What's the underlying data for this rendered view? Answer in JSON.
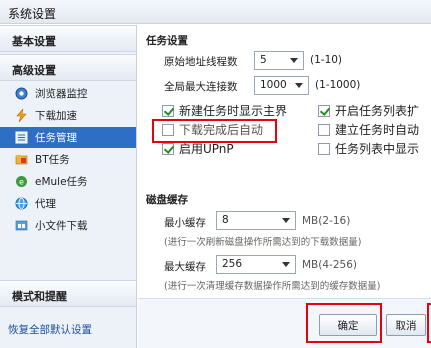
{
  "window": {
    "title": "系统设置"
  },
  "sidebar": {
    "sections": {
      "basic": "基本设置",
      "advanced": "高级设置",
      "mode": "模式和提醒"
    },
    "items": [
      {
        "label": "浏览器监控",
        "icon": "browser-monitor-icon"
      },
      {
        "label": "下载加速",
        "icon": "lightning-icon"
      },
      {
        "label": "任务管理",
        "icon": "task-list-icon",
        "active": true
      },
      {
        "label": "BT任务",
        "icon": "bt-folder-icon"
      },
      {
        "label": "eMule任务",
        "icon": "emule-icon"
      },
      {
        "label": "代理",
        "icon": "proxy-globe-icon"
      },
      {
        "label": "小文件下载",
        "icon": "small-file-icon"
      }
    ],
    "restore_link": "恢复全部默认设置"
  },
  "task_settings": {
    "title": "任务设置",
    "origin_threads_label": "原始地址线程数",
    "origin_threads_value": "5",
    "origin_threads_range": "(1-10)",
    "max_conn_label": "全局最大连接数",
    "max_conn_value": "1000",
    "max_conn_range": "(1-1000)",
    "checkboxes": [
      {
        "label": "新建任务时显示主界",
        "checked": true
      },
      {
        "label": "开启任务列表扩",
        "checked": true
      },
      {
        "label": "下载完成后自动",
        "checked": false
      },
      {
        "label": "建立任务时自动",
        "checked": false
      },
      {
        "label": "启用UPnP",
        "checked": true
      },
      {
        "label": "任务列表中显示",
        "checked": false
      }
    ]
  },
  "disk_cache": {
    "title": "磁盘缓存",
    "min_label": "最小缓存",
    "min_value": "8",
    "min_range": "MB(2-16)",
    "min_hint": "(进行一次刷新磁盘操作所需达到的下载数据量)",
    "max_label": "最大缓存",
    "max_value": "256",
    "max_range": "MB(4-256)",
    "max_hint": "(进行一次清理缓存数据操作所需达到的缓存数据量)"
  },
  "buttons": {
    "ok": "确定",
    "cancel": "取消"
  },
  "colors": {
    "highlight": "#e8000f",
    "active_nav": "#2d6fc4"
  }
}
